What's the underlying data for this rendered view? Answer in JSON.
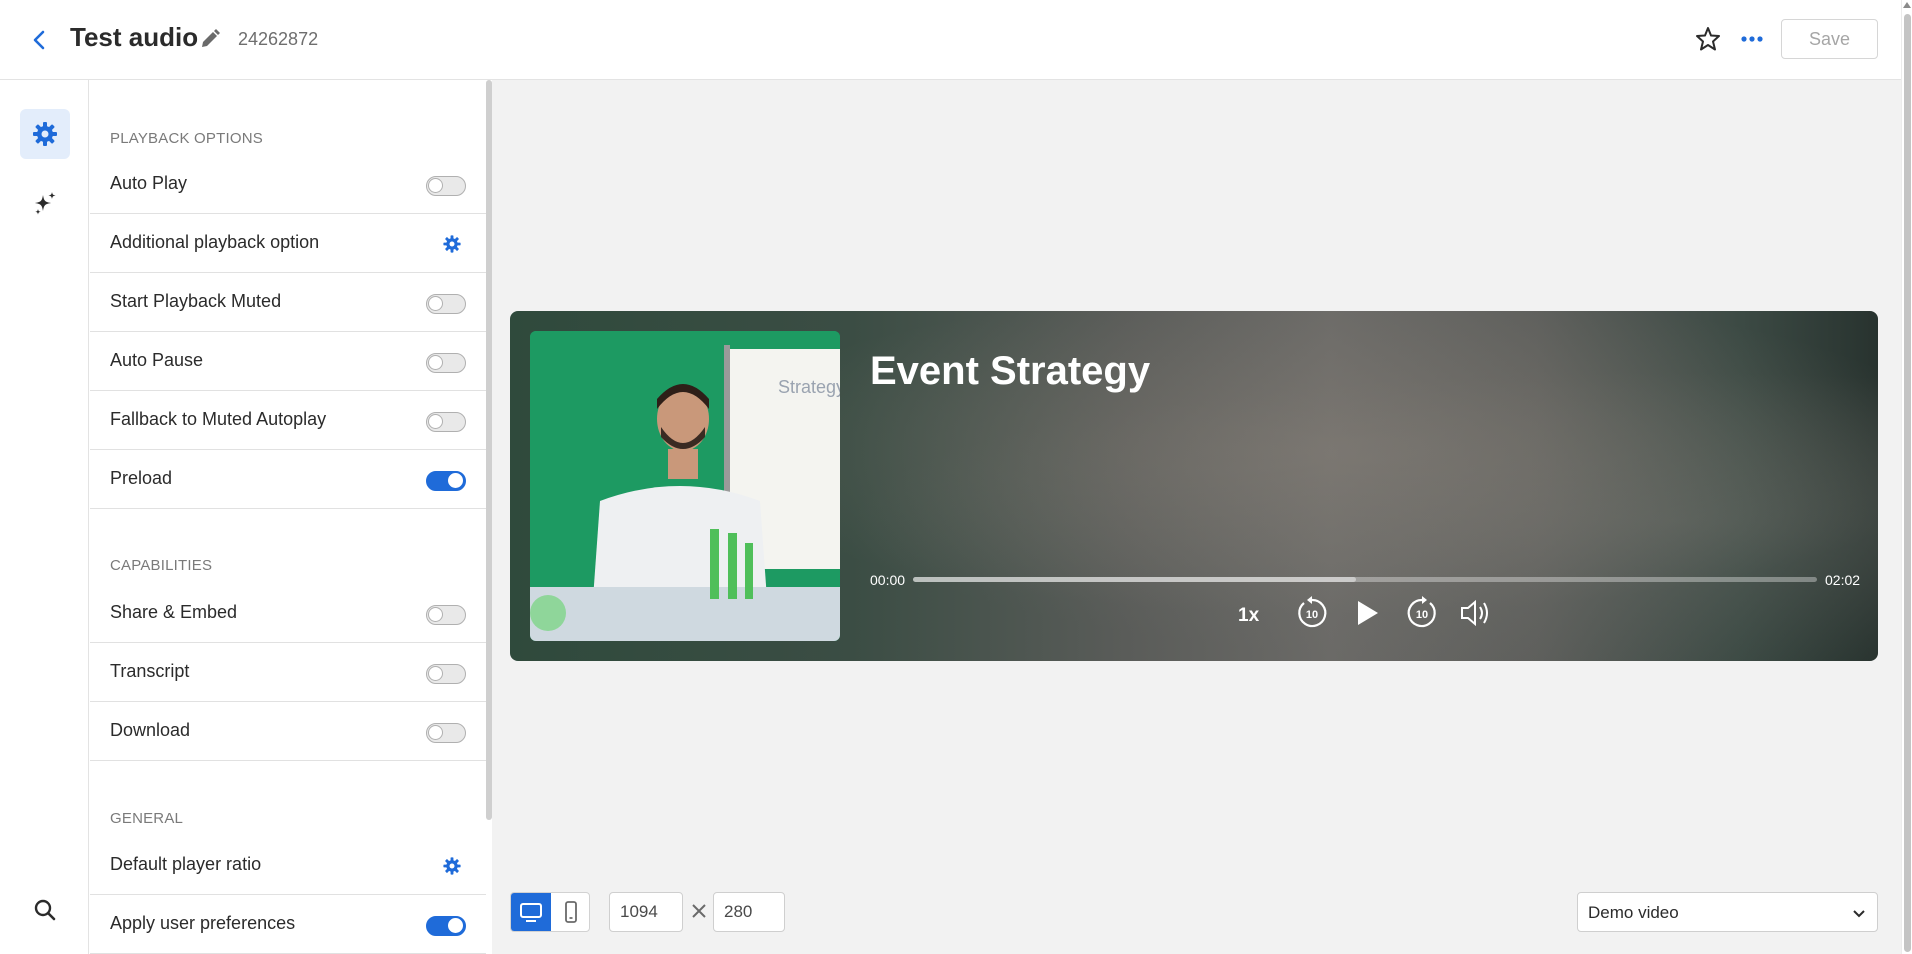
{
  "header": {
    "title": "Test audio",
    "media_id": "24262872",
    "save_label": "Save"
  },
  "rail": {
    "items": [
      {
        "icon": "gear-icon",
        "active": true
      },
      {
        "icon": "sparkles-icon",
        "active": false
      }
    ],
    "bottom_icon": "search-icon"
  },
  "panel": {
    "sections": [
      {
        "title": "PLAYBACK OPTIONS",
        "rows": [
          {
            "label": "Auto Play",
            "control": "toggle",
            "on": false
          },
          {
            "label": "Additional playback option",
            "control": "gear"
          },
          {
            "label": "Start Playback Muted",
            "control": "toggle",
            "on": false
          },
          {
            "label": "Auto Pause",
            "control": "toggle",
            "on": false
          },
          {
            "label": "Fallback to Muted Autoplay",
            "control": "toggle",
            "on": false
          },
          {
            "label": "Preload",
            "control": "toggle",
            "on": true
          }
        ]
      },
      {
        "title": "CAPABILITIES",
        "rows": [
          {
            "label": "Share & Embed",
            "control": "toggle",
            "on": false
          },
          {
            "label": "Transcript",
            "control": "toggle",
            "on": false
          },
          {
            "label": "Download",
            "control": "toggle",
            "on": false
          }
        ]
      },
      {
        "title": "GENERAL",
        "rows": [
          {
            "label": "Default player ratio",
            "control": "gear"
          },
          {
            "label": "Apply user preferences",
            "control": "toggle",
            "on": true
          }
        ]
      }
    ]
  },
  "player": {
    "title": "Event Strategy",
    "time_current": "00:00",
    "time_total": "02:02",
    "progress_fraction": 0.49,
    "rate": "1x",
    "thumbnail_text": "Strategy",
    "controls": [
      "rewind-10-icon",
      "play-icon",
      "forward-10-icon",
      "volume-icon"
    ]
  },
  "toolbar": {
    "devices": [
      {
        "icon": "desktop-icon",
        "active": true
      },
      {
        "icon": "mobile-icon",
        "active": false
      }
    ],
    "width_value": "1094",
    "height_value": "280",
    "select_value": "Demo video"
  },
  "colors": {
    "accent": "#1f6bd9",
    "rail_active_bg": "#e3edfb",
    "preview_bg": "#f2f2f2"
  }
}
